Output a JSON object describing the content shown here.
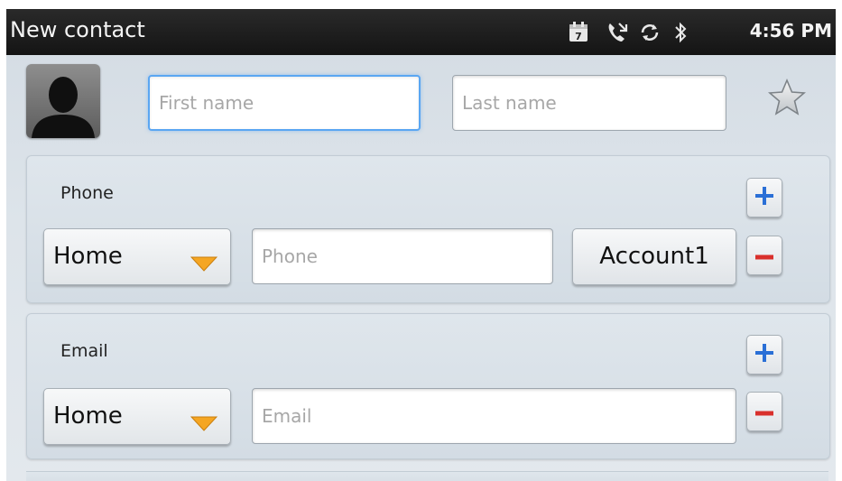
{
  "status_bar": {
    "title": "New contact",
    "time": "4:56 PM",
    "icons": [
      "calendar-icon",
      "missed-call-icon",
      "sync-icon",
      "bluetooth-icon"
    ],
    "calendar_day": "7"
  },
  "contact": {
    "first_name": {
      "value": "",
      "placeholder": "First name"
    },
    "last_name": {
      "value": "",
      "placeholder": "Last name"
    }
  },
  "phone_section": {
    "label": "Phone",
    "type_selected": "Home",
    "placeholder": "Phone",
    "account_label": "Account1"
  },
  "email_section": {
    "label": "Email",
    "type_selected": "Home",
    "placeholder": "Email"
  },
  "colors": {
    "add_icon": "#2a6fd6",
    "remove_icon": "#d9302c",
    "focus_border": "#5aa6f2",
    "dropdown_arrow": "#f5a623"
  }
}
